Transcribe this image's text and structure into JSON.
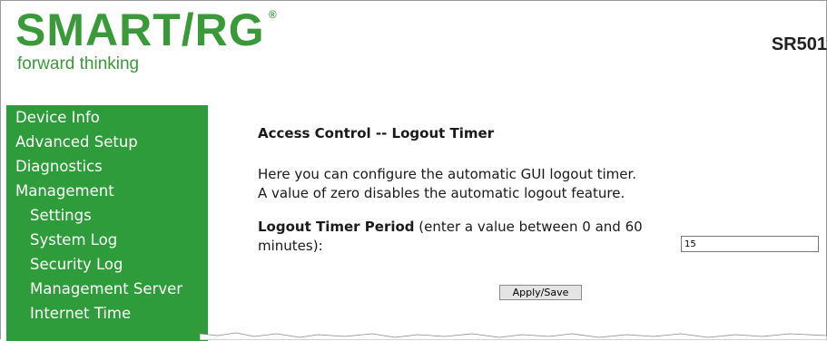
{
  "header": {
    "brand": "SMART/RG",
    "registered": "®",
    "tagline": "forward thinking",
    "model": "SR501"
  },
  "sidebar": {
    "items": [
      {
        "label": "Device Info",
        "indent": false
      },
      {
        "label": "Advanced Setup",
        "indent": false
      },
      {
        "label": "Diagnostics",
        "indent": false
      },
      {
        "label": "Management",
        "indent": false
      },
      {
        "label": "Settings",
        "indent": true
      },
      {
        "label": "System Log",
        "indent": true
      },
      {
        "label": "Security Log",
        "indent": true
      },
      {
        "label": "Management Server",
        "indent": true
      },
      {
        "label": "Internet Time",
        "indent": true
      }
    ]
  },
  "main": {
    "title": "Access Control -- Logout Timer",
    "description_line1": "Here you can configure the automatic GUI logout timer.",
    "description_line2": "A value of zero disables the automatic logout feature.",
    "field_label_bold": "Logout Timer Period",
    "field_label_hint": " (enter a value between 0 and 60 minutes):",
    "field_value": "15",
    "apply_label": "Apply/Save"
  },
  "colors": {
    "brand_green": "#3a9a3a",
    "sidebar_green": "#2e9c3a"
  }
}
